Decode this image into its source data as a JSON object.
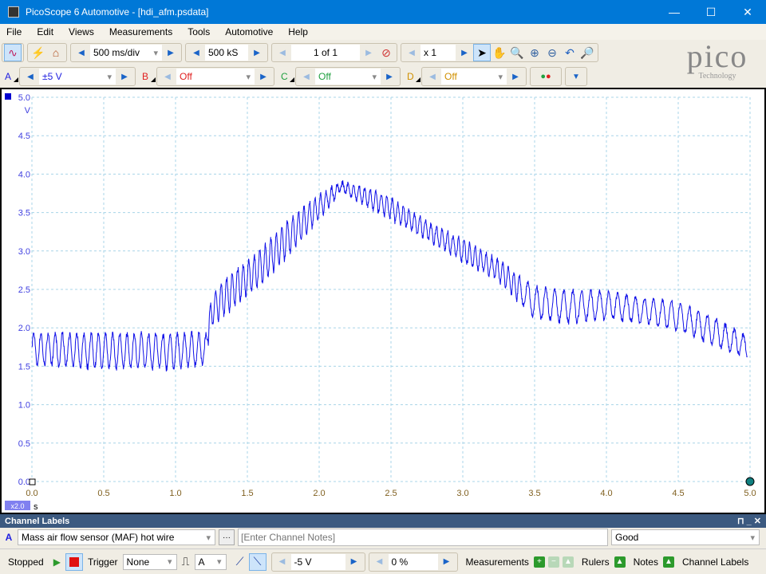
{
  "window": {
    "title": "PicoScope 6 Automotive - [hdi_afm.psdata]",
    "minimize": "—",
    "maximize": "☐",
    "close": "✕"
  },
  "menu": [
    "File",
    "Edit",
    "Views",
    "Measurements",
    "Tools",
    "Automotive",
    "Help"
  ],
  "toolbar": {
    "timebase": "500 ms/div",
    "samples": "500 kS",
    "buffer": "1 of 1",
    "zoom": "x 1"
  },
  "channels": [
    {
      "letter": "A",
      "range": "±5 V",
      "color": "#2020e0"
    },
    {
      "letter": "B",
      "range": "Off",
      "color": "#e02020"
    },
    {
      "letter": "C",
      "range": "Off",
      "color": "#20a040"
    },
    {
      "letter": "D",
      "range": "Off",
      "color": "#d09000"
    }
  ],
  "logo": {
    "text": "pico",
    "sub": "Technology"
  },
  "chart_data": {
    "type": "line",
    "xlabel": "s",
    "ylabel": "V",
    "xlim": [
      0,
      5
    ],
    "ylim": [
      0,
      5
    ],
    "xticks": [
      "0.0",
      "0.5",
      "1.0",
      "1.5",
      "2.0",
      "2.5",
      "3.0",
      "3.5",
      "4.0",
      "4.5",
      "5.0"
    ],
    "yticks": [
      "0.0",
      "0.5",
      "1.0",
      "1.5",
      "2.0",
      "2.5",
      "3.0",
      "3.5",
      "4.0",
      "4.5",
      "5.0"
    ],
    "x_zoom_badge": "x2.0",
    "grid": true,
    "series": [
      {
        "channel": "A",
        "color": "#1010e8",
        "envelope": [
          [
            0.0,
            1.5,
            1.95
          ],
          [
            0.5,
            1.45,
            1.95
          ],
          [
            1.0,
            1.45,
            1.95
          ],
          [
            1.22,
            1.5,
            1.95
          ],
          [
            1.25,
            2.0,
            2.45
          ],
          [
            1.4,
            2.25,
            2.75
          ],
          [
            1.6,
            2.55,
            3.05
          ],
          [
            1.8,
            2.95,
            3.45
          ],
          [
            2.0,
            3.4,
            3.75
          ],
          [
            2.15,
            3.78,
            3.9
          ],
          [
            2.3,
            3.6,
            3.85
          ],
          [
            2.5,
            3.4,
            3.7
          ],
          [
            2.75,
            3.15,
            3.4
          ],
          [
            3.0,
            2.85,
            3.15
          ],
          [
            3.25,
            2.6,
            2.9
          ],
          [
            3.5,
            2.1,
            2.55
          ],
          [
            3.75,
            2.05,
            2.5
          ],
          [
            4.0,
            2.1,
            2.5
          ],
          [
            4.25,
            2.05,
            2.4
          ],
          [
            4.5,
            1.95,
            2.35
          ],
          [
            4.75,
            1.75,
            2.15
          ],
          [
            4.98,
            1.6,
            1.9
          ]
        ]
      }
    ]
  },
  "channel_labels": {
    "header": "Channel Labels",
    "pin": "⊓ _ ✕",
    "letter": "A",
    "label": "Mass air flow sensor (MAF) hot wire",
    "more": "···",
    "notes_placeholder": "[Enter Channel Notes]",
    "rating": "Good"
  },
  "status": {
    "state": "Stopped",
    "trigger_label": "Trigger",
    "trigger_mode": "None",
    "trigger_channel": "A",
    "trigger_level": "-5 V",
    "pretrigger": "0 %",
    "measurements": "Measurements",
    "rulers": "Rulers",
    "notes": "Notes",
    "channel_labels": "Channel Labels"
  }
}
